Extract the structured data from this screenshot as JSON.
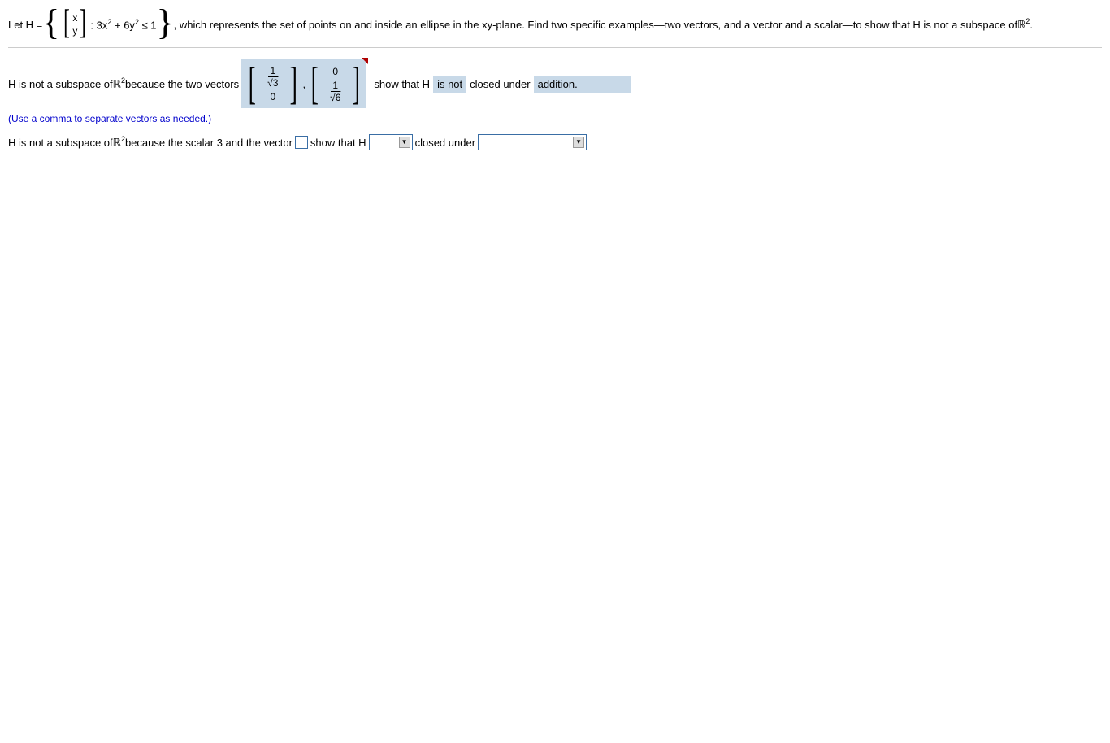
{
  "q": {
    "let": "Let H = ",
    "xy_top": "x",
    "xy_bot": "y",
    "cond": ": 3x",
    "cond2": " + 6y",
    "cond3": " ≤ 1",
    "rest": ", which represents the set of points on and inside an ellipse in the xy-plane. Find two specific examples—two vectors, and a vector and a scalar—to show that H is not a subspace of ",
    "R": "ℝ",
    "period": "."
  },
  "part1": {
    "lead": "H is not a subspace of ",
    "R": "ℝ",
    "because": " because the two vectors",
    "v1_top_num": "1",
    "v1_top_den_sym": "√",
    "v1_top_den_rad": "3",
    "v1_bot": "0",
    "comma": ",",
    "v2_top": "0",
    "v2_bot_num": "1",
    "v2_bot_den_sym": "√",
    "v2_bot_den_rad": "6",
    "show": "show that H",
    "isnot": "is not",
    "closed": "closed under",
    "op": "addition."
  },
  "hint": "(Use a comma to separate vectors as needed.)",
  "part2": {
    "lead": "H is not a subspace of ",
    "R": "ℝ",
    "because": " because the scalar 3 and the vector",
    "show": "show that H",
    "closed": "closed under"
  }
}
